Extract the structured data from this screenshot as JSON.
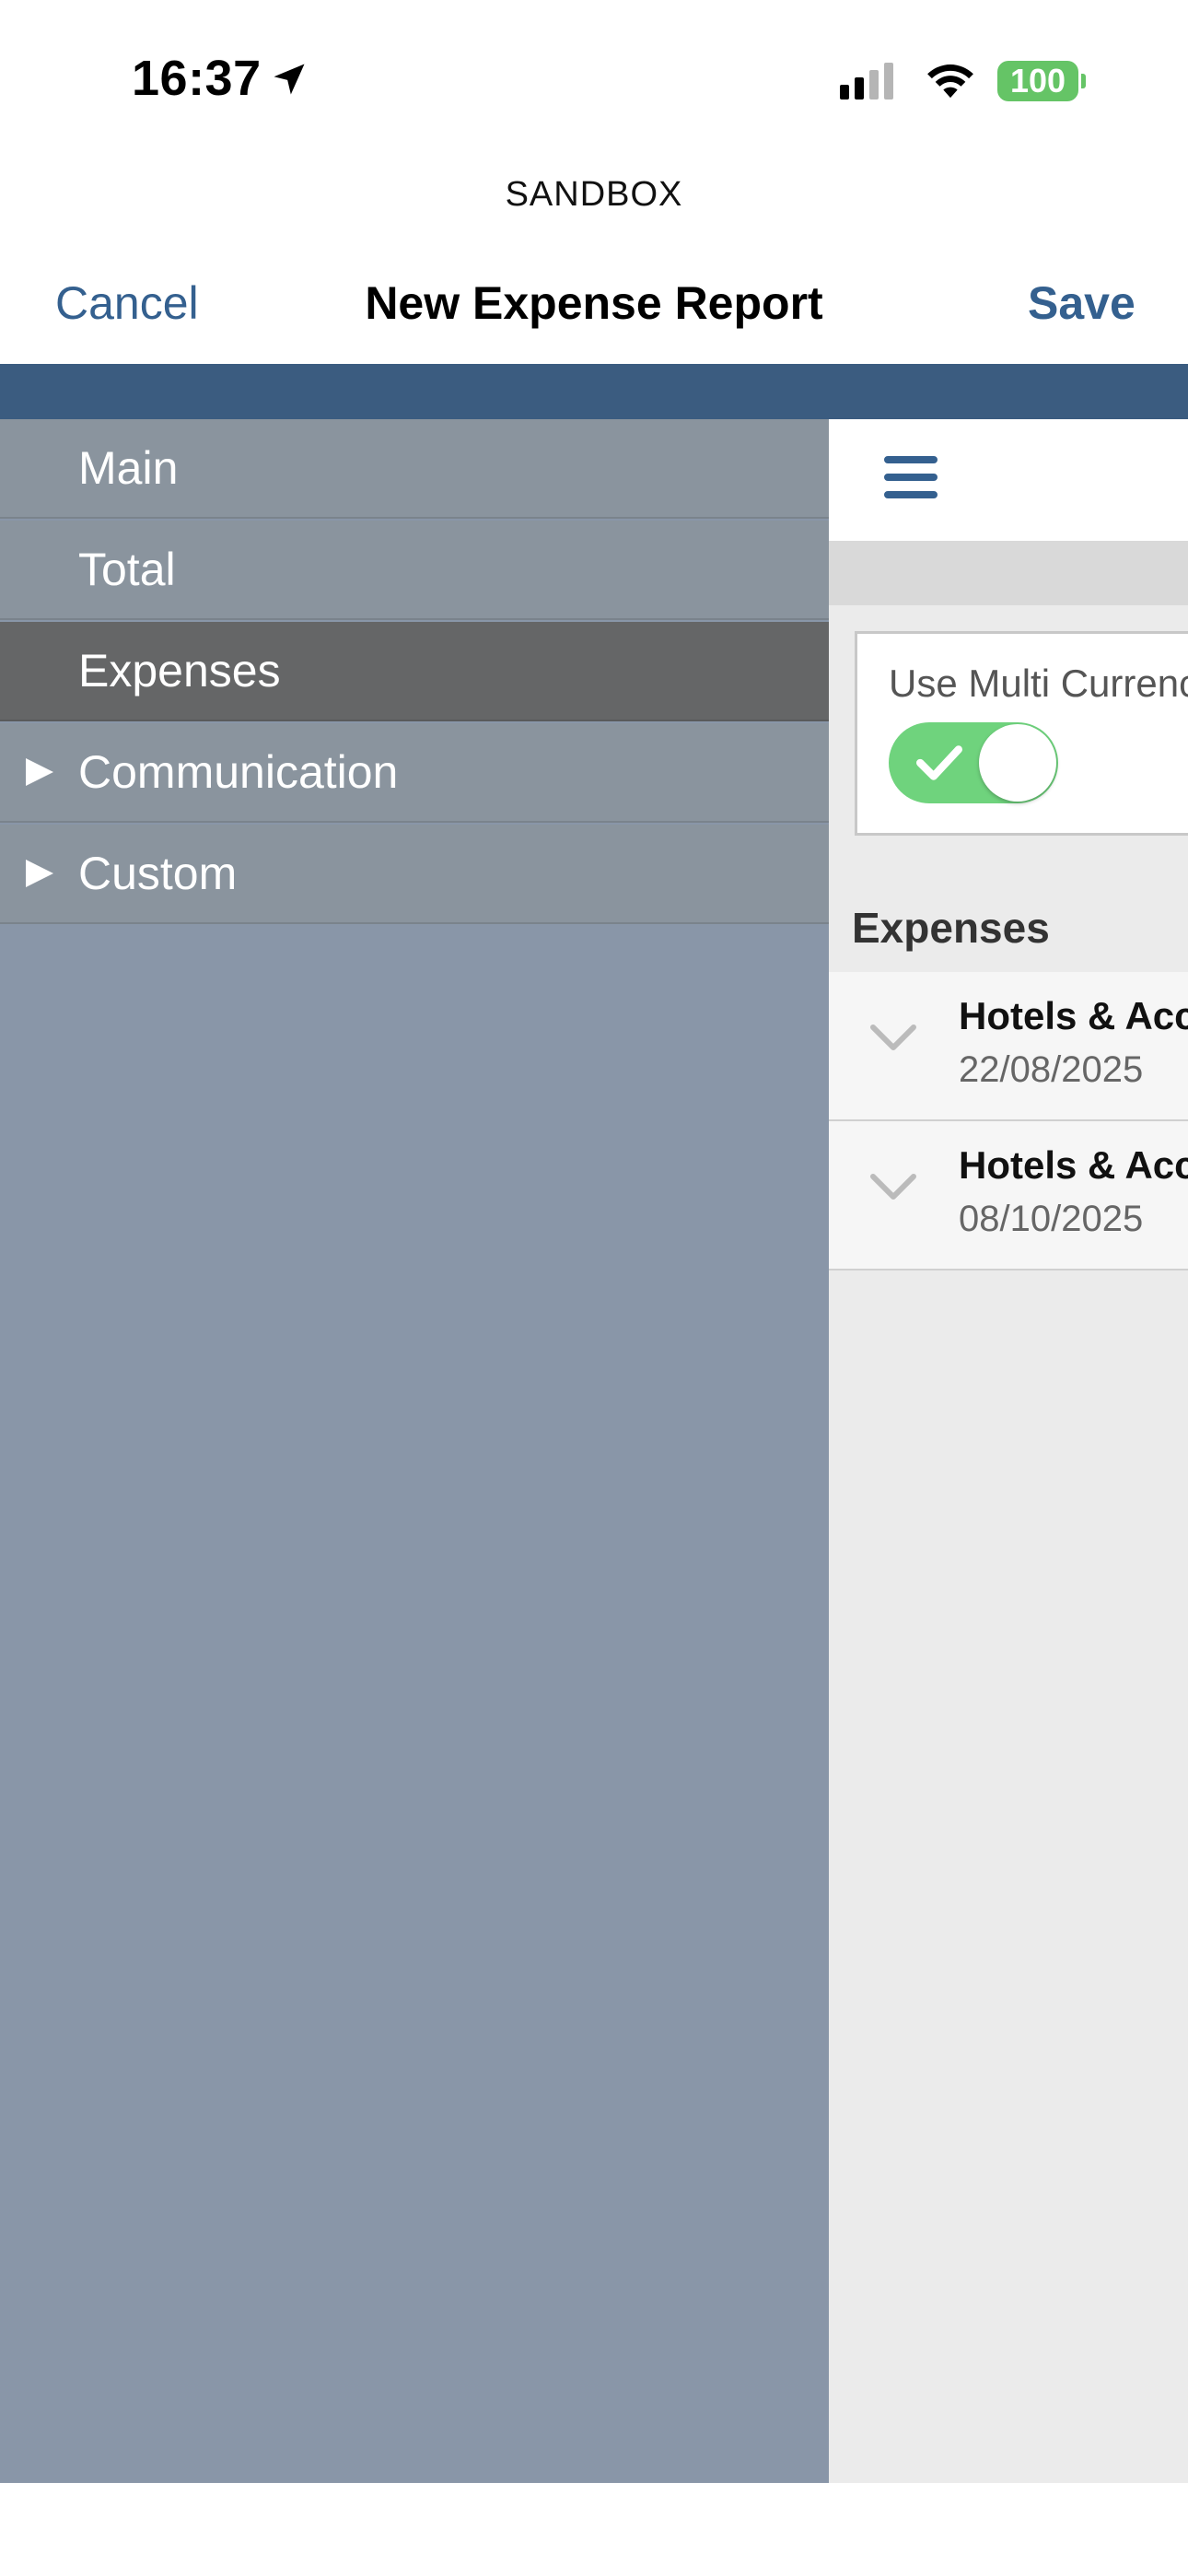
{
  "status_bar": {
    "time": "16:37",
    "battery": "100",
    "icons": [
      "location-arrow-icon",
      "cellular-signal-icon",
      "wifi-icon",
      "battery-icon"
    ]
  },
  "environment_label": "SANDBOX",
  "nav": {
    "cancel_label": "Cancel",
    "title": "New Expense Report",
    "save_label": "Save"
  },
  "sidebar": {
    "items": [
      {
        "label": "Main",
        "expandable": false,
        "active": false
      },
      {
        "label": "Total",
        "expandable": false,
        "active": false
      },
      {
        "label": "Expenses",
        "expandable": false,
        "active": true
      },
      {
        "label": "Communication",
        "expandable": true,
        "active": false
      },
      {
        "label": "Custom",
        "expandable": true,
        "active": false
      }
    ]
  },
  "content": {
    "multi_currency": {
      "label": "Use Multi Currency",
      "enabled": true
    },
    "section_title": "Expenses",
    "expenses": [
      {
        "title": "Hotels & Accommodation",
        "date": "22/08/2025"
      },
      {
        "title": "Hotels & Accommodation",
        "date": "08/10/2025"
      }
    ]
  },
  "colors": {
    "accent": "#34608f",
    "blue_band": "#3b5c80",
    "sidebar_bg": "#8996a8",
    "sidebar_active": "#656667",
    "toggle_on": "#6fd37d",
    "battery": "#65c466"
  }
}
